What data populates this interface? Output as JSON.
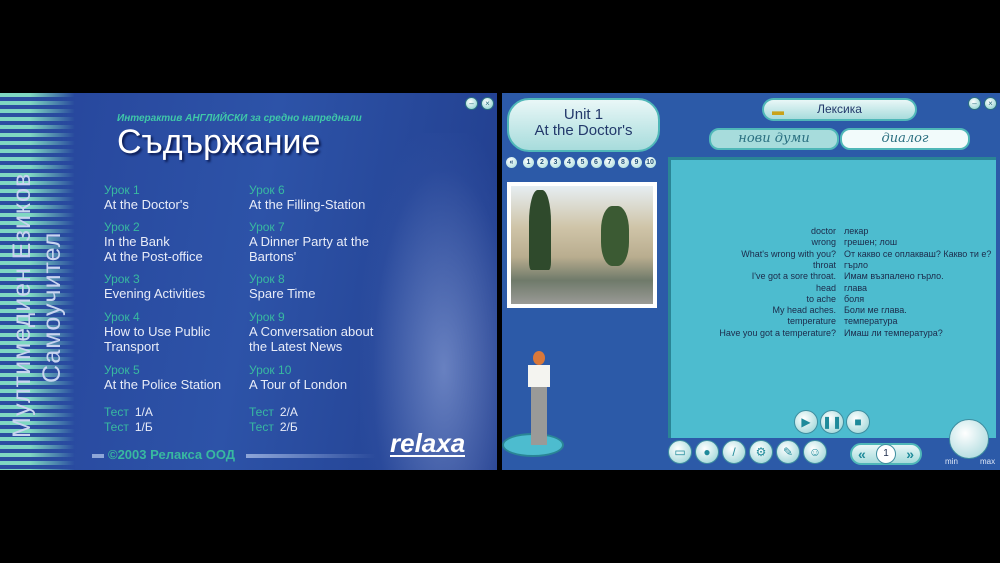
{
  "menu": {
    "side_title_line1": "Мултимедиен Езиков",
    "side_title_line2": "Самоучител",
    "subtitle": "Интерактив АНГЛИЙСКИ за средно напреднали",
    "title": "Съдържание",
    "lessons": [
      {
        "label": "Урок 1",
        "title": [
          "At the Doctor's"
        ]
      },
      {
        "label": "Урок 2",
        "title": [
          "In the Bank",
          "At the Post-office"
        ]
      },
      {
        "label": "Урок 3",
        "title": [
          "Evening Activities"
        ]
      },
      {
        "label": "Урок 4",
        "title": [
          "How to Use Public",
          "Transport"
        ]
      },
      {
        "label": "Урок 5",
        "title": [
          "At the Police Station"
        ]
      },
      {
        "label": "Урок 6",
        "title": [
          "At the Filling-Station"
        ]
      },
      {
        "label": "Урок 7",
        "title": [
          "A Dinner Party at the",
          "Bartons'"
        ]
      },
      {
        "label": "Урок 8",
        "title": [
          "Spare Time"
        ]
      },
      {
        "label": "Урок 9",
        "title": [
          "A Conversation about",
          "the Latest News"
        ]
      },
      {
        "label": "Урок 10",
        "title": [
          "A Tour of London"
        ]
      }
    ],
    "tests": [
      {
        "label": "Тест",
        "value": "1/А"
      },
      {
        "label": "Тест",
        "value": "1/Б"
      },
      {
        "label": "Тест",
        "value": "2/А"
      },
      {
        "label": "Тест",
        "value": "2/Б"
      }
    ],
    "copyright": "©2003 Релакса ООД",
    "logo": "relaxa"
  },
  "lesson": {
    "unit": "Unit 1",
    "unit_title": "At the Doctor's",
    "back": "«",
    "pages": [
      "1",
      "2",
      "3",
      "4",
      "5",
      "6",
      "7",
      "8",
      "9",
      "10"
    ],
    "section": "Лексика",
    "tabs": [
      "нови думи",
      "диалог"
    ],
    "vocab": [
      [
        "doctor",
        "лекар"
      ],
      [
        "wrong",
        "грешен; лош"
      ],
      [
        "What's wrong with you?",
        "От какво се оплакваш? Какво ти е?"
      ],
      [
        "throat",
        "гърло"
      ],
      [
        "I've got a sore throat.",
        "Имам възпалено гърло."
      ],
      [
        "head",
        "глава"
      ],
      [
        "to ache",
        "боля"
      ],
      [
        "My head aches.",
        "Боли ме глава."
      ],
      [
        "temperature",
        "температура"
      ],
      [
        "Have you got a temperature?",
        "Имаш ли температура?"
      ]
    ],
    "page": "1",
    "prev": "«",
    "next": "»",
    "volume_min": "min",
    "volume_max": "max"
  }
}
